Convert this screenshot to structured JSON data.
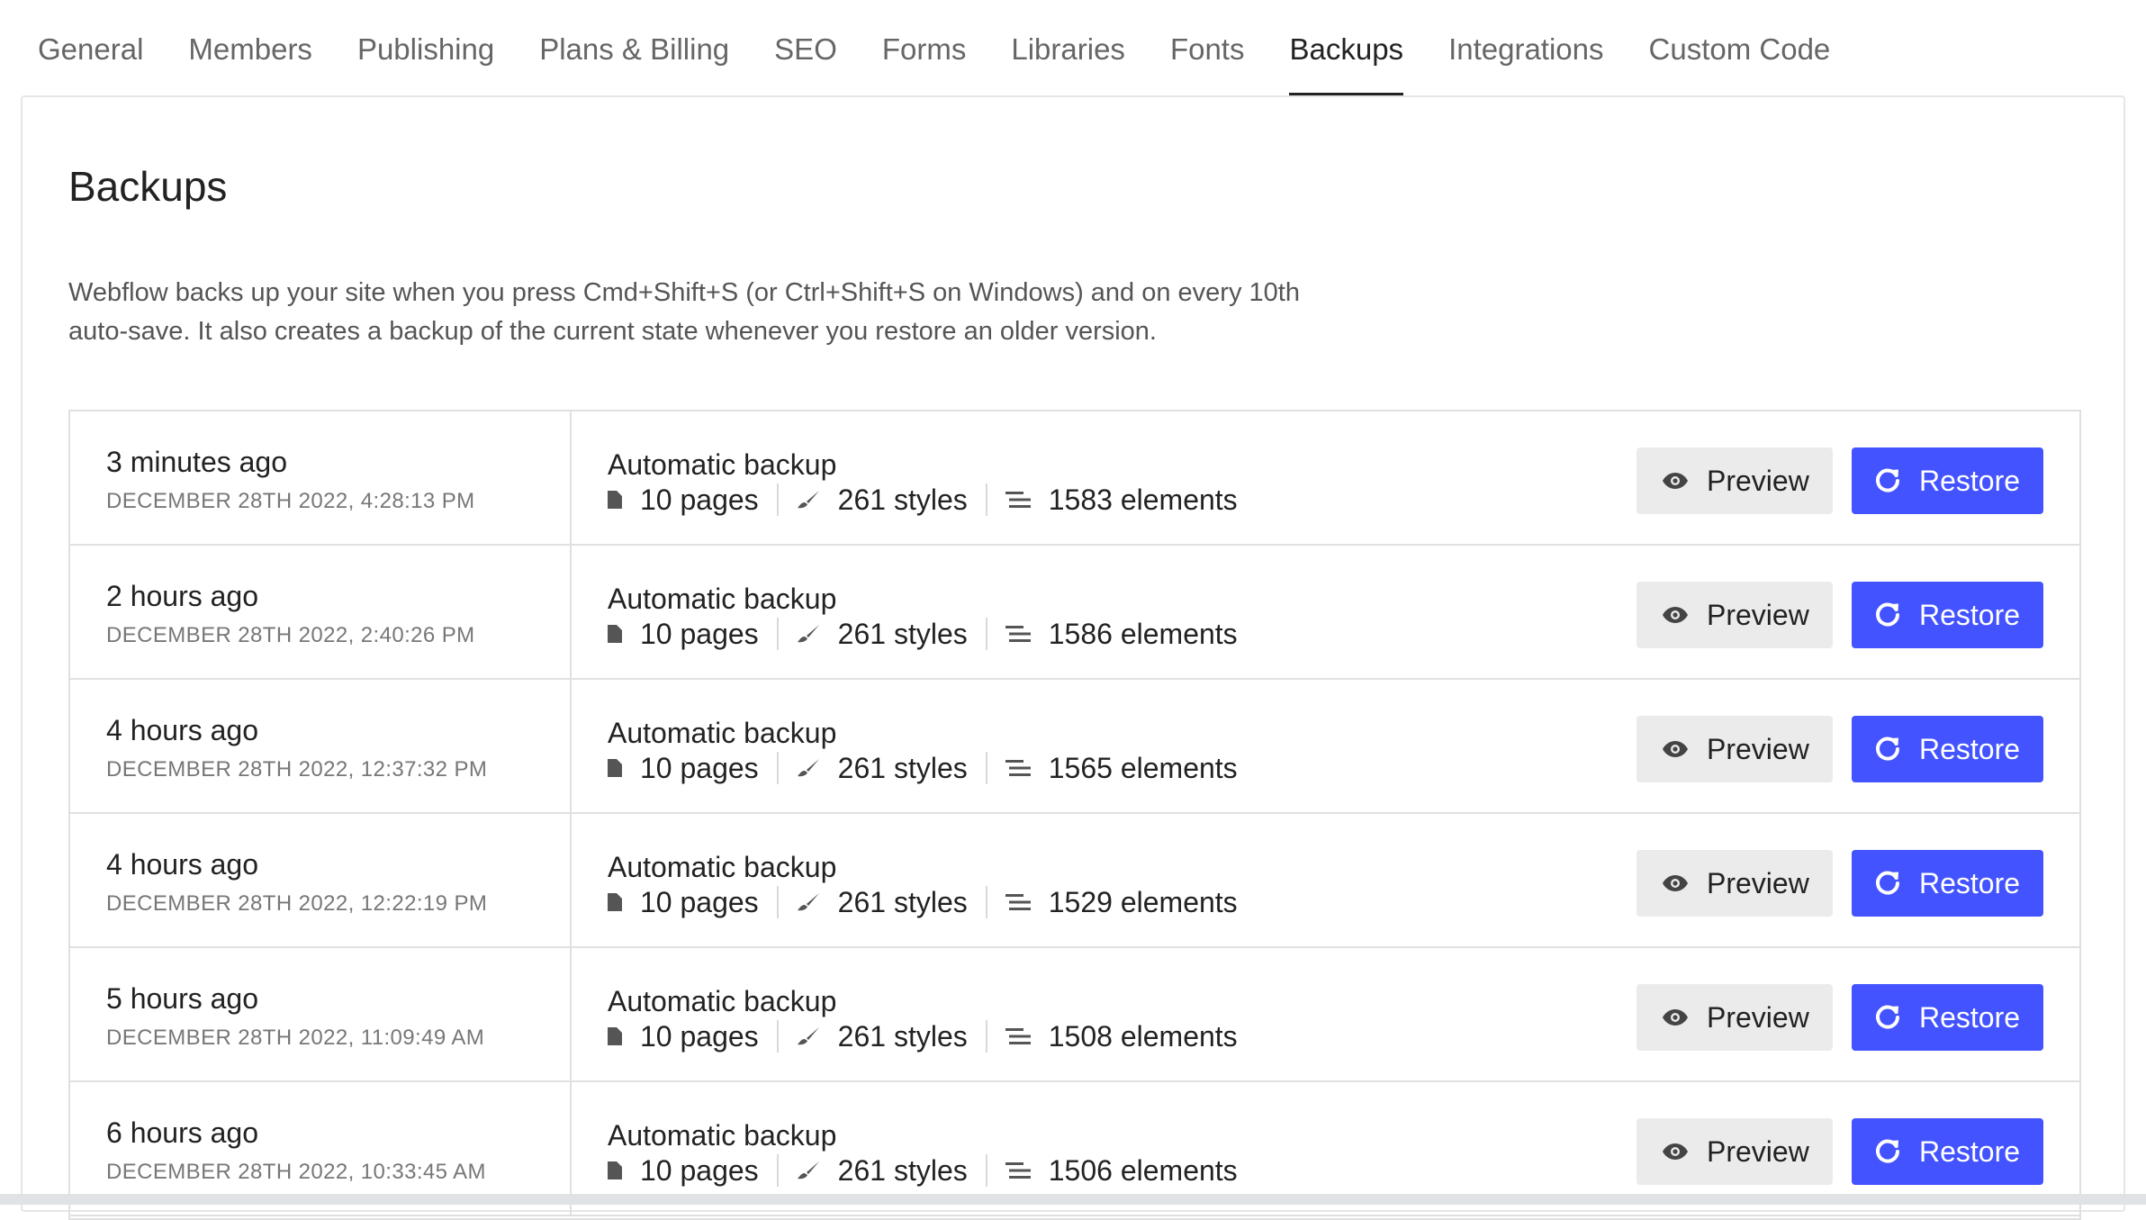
{
  "tabs": [
    {
      "label": "General",
      "active": false
    },
    {
      "label": "Members",
      "active": false
    },
    {
      "label": "Publishing",
      "active": false
    },
    {
      "label": "Plans & Billing",
      "active": false
    },
    {
      "label": "SEO",
      "active": false
    },
    {
      "label": "Forms",
      "active": false
    },
    {
      "label": "Libraries",
      "active": false
    },
    {
      "label": "Fonts",
      "active": false
    },
    {
      "label": "Backups",
      "active": true
    },
    {
      "label": "Integrations",
      "active": false
    },
    {
      "label": "Custom Code",
      "active": false
    }
  ],
  "panel": {
    "title": "Backups",
    "description": "Webflow backs up your site when you press Cmd+Shift+S (or Ctrl+Shift+S on Windows) and on every 10th auto-save. It also creates a backup of the current state whenever you restore an older version."
  },
  "buttons": {
    "preview_label": "Preview",
    "restore_label": "Restore"
  },
  "colors": {
    "accent": "#4353ff",
    "preview_bg": "#ebebeb"
  },
  "backups": [
    {
      "relative": "3 minutes ago",
      "timestamp": "DECEMBER 28TH 2022, 4:28:13 PM",
      "type": "Automatic backup",
      "pages": "10 pages",
      "styles": "261 styles",
      "elements": "1583 elements"
    },
    {
      "relative": "2 hours ago",
      "timestamp": "DECEMBER 28TH 2022, 2:40:26 PM",
      "type": "Automatic backup",
      "pages": "10 pages",
      "styles": "261 styles",
      "elements": "1586 elements"
    },
    {
      "relative": "4 hours ago",
      "timestamp": "DECEMBER 28TH 2022, 12:37:32 PM",
      "type": "Automatic backup",
      "pages": "10 pages",
      "styles": "261 styles",
      "elements": "1565 elements"
    },
    {
      "relative": "4 hours ago",
      "timestamp": "DECEMBER 28TH 2022, 12:22:19 PM",
      "type": "Automatic backup",
      "pages": "10 pages",
      "styles": "261 styles",
      "elements": "1529 elements"
    },
    {
      "relative": "5 hours ago",
      "timestamp": "DECEMBER 28TH 2022, 11:09:49 AM",
      "type": "Automatic backup",
      "pages": "10 pages",
      "styles": "261 styles",
      "elements": "1508 elements"
    },
    {
      "relative": "6 hours ago",
      "timestamp": "DECEMBER 28TH 2022, 10:33:45 AM",
      "type": "Automatic backup",
      "pages": "10 pages",
      "styles": "261 styles",
      "elements": "1506 elements"
    }
  ]
}
